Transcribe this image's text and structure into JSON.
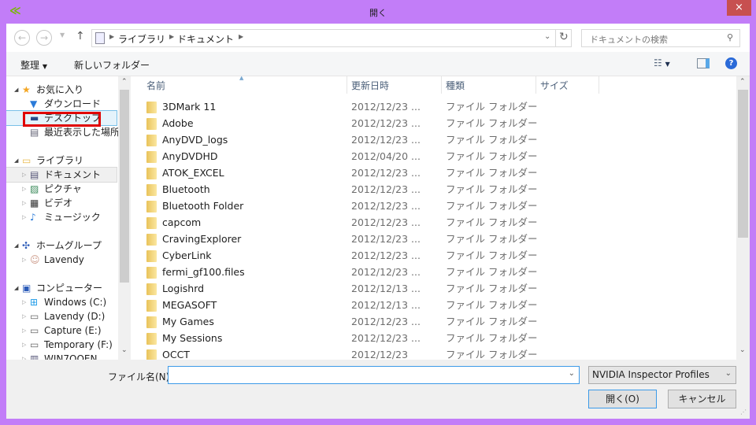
{
  "window": {
    "title": "開く",
    "close_icon": "×"
  },
  "nav": {
    "back": "←",
    "forward": "→",
    "up": "↑",
    "breadcrumb": [
      "ライブラリ",
      "ドキュメント"
    ],
    "refresh": "↻",
    "search_placeholder": "ドキュメントの検索"
  },
  "toolbar": {
    "organize": "整理",
    "new_folder": "新しいフォルダー"
  },
  "sidebar": {
    "items": [
      {
        "label": "お気に入り",
        "level": 0,
        "icon": "star-icon"
      },
      {
        "label": "ダウンロード",
        "level": 1,
        "icon": "download-folder-icon"
      },
      {
        "label": "デスクトップ",
        "level": 1,
        "icon": "desktop-icon",
        "highlighted": true
      },
      {
        "label": "最近表示した場所",
        "level": 1,
        "icon": "recent-places-icon"
      },
      {
        "label": "ライブラリ",
        "level": 0,
        "icon": "library-icon"
      },
      {
        "label": "ドキュメント",
        "level": 1,
        "icon": "document-icon",
        "selected": true
      },
      {
        "label": "ピクチャ",
        "level": 1,
        "icon": "pictures-icon"
      },
      {
        "label": "ビデオ",
        "level": 1,
        "icon": "video-icon"
      },
      {
        "label": "ミュージック",
        "level": 1,
        "icon": "music-icon"
      },
      {
        "label": "ホームグループ",
        "level": 0,
        "icon": "homegroup-icon"
      },
      {
        "label": "Lavendy",
        "level": 1,
        "icon": "user-avatar-icon"
      },
      {
        "label": "コンピューター",
        "level": 0,
        "icon": "computer-icon"
      },
      {
        "label": "Windows (C:)",
        "level": 1,
        "icon": "windows-drive-icon"
      },
      {
        "label": "Lavendy (D:)",
        "level": 1,
        "icon": "drive-icon"
      },
      {
        "label": "Capture (E:)",
        "level": 1,
        "icon": "drive-icon"
      },
      {
        "label": "Temporary (F:)",
        "level": 1,
        "icon": "drive-icon"
      },
      {
        "label": "WIN7OOEN",
        "level": 1,
        "icon": "network-drive-icon"
      }
    ]
  },
  "columns": [
    "名前",
    "更新日時",
    "種類",
    "サイズ"
  ],
  "files": [
    {
      "name": "3DMark 11",
      "date": "2012/12/23 ...",
      "type": "ファイル フォルダー"
    },
    {
      "name": "Adobe",
      "date": "2012/12/23 ...",
      "type": "ファイル フォルダー"
    },
    {
      "name": "AnyDVD_logs",
      "date": "2012/12/23 ...",
      "type": "ファイル フォルダー"
    },
    {
      "name": "AnyDVDHD",
      "date": "2012/04/20 ...",
      "type": "ファイル フォルダー"
    },
    {
      "name": "ATOK_EXCEL",
      "date": "2012/12/23 ...",
      "type": "ファイル フォルダー"
    },
    {
      "name": "Bluetooth",
      "date": "2012/12/23 ...",
      "type": "ファイル フォルダー"
    },
    {
      "name": "Bluetooth Folder",
      "date": "2012/12/23 ...",
      "type": "ファイル フォルダー"
    },
    {
      "name": "capcom",
      "date": "2012/12/23 ...",
      "type": "ファイル フォルダー"
    },
    {
      "name": "CravingExplorer",
      "date": "2012/12/23 ...",
      "type": "ファイル フォルダー"
    },
    {
      "name": "CyberLink",
      "date": "2012/12/23 ...",
      "type": "ファイル フォルダー"
    },
    {
      "name": "fermi_gf100.files",
      "date": "2012/12/23 ...",
      "type": "ファイル フォルダー"
    },
    {
      "name": "Logishrd",
      "date": "2012/12/13 ...",
      "type": "ファイル フォルダー"
    },
    {
      "name": "MEGASOFT",
      "date": "2012/12/13 ...",
      "type": "ファイル フォルダー"
    },
    {
      "name": "My Games",
      "date": "2012/12/23 ...",
      "type": "ファイル フォルダー"
    },
    {
      "name": "My Sessions",
      "date": "2012/12/23 ...",
      "type": "ファイル フォルダー"
    },
    {
      "name": "OCCT",
      "date": "2012/12/23",
      "type": "ファイル フォルダー"
    }
  ],
  "footer": {
    "filename_label": "ファイル名(N):",
    "filename_value": "",
    "filter": "NVIDIA Inspector Profiles",
    "open": "開く(O)",
    "cancel": "キャンセル"
  },
  "colors": {
    "frame": "#c27df8",
    "close": "#c75050",
    "highlight_box": "#e00000",
    "accent": "#3c9ae8"
  }
}
